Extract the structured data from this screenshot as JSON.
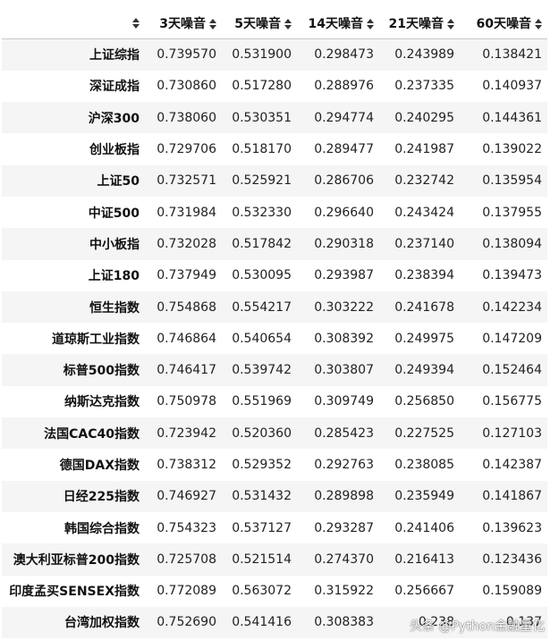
{
  "table": {
    "headers": [
      "3天噪音",
      "5天噪音",
      "14天噪音",
      "21天噪音",
      "60天噪音"
    ],
    "rows": [
      {
        "name": "上证综指",
        "values": [
          "0.739570",
          "0.531900",
          "0.298473",
          "0.243989",
          "0.138421"
        ]
      },
      {
        "name": "深证成指",
        "values": [
          "0.730860",
          "0.517280",
          "0.288976",
          "0.237335",
          "0.140937"
        ]
      },
      {
        "name": "沪深300",
        "values": [
          "0.738060",
          "0.530351",
          "0.294774",
          "0.240295",
          "0.144361"
        ]
      },
      {
        "name": "创业板指",
        "values": [
          "0.729706",
          "0.518170",
          "0.289477",
          "0.241987",
          "0.139022"
        ]
      },
      {
        "name": "上证50",
        "values": [
          "0.732571",
          "0.525921",
          "0.286706",
          "0.232742",
          "0.135954"
        ]
      },
      {
        "name": "中证500",
        "values": [
          "0.731984",
          "0.532330",
          "0.296640",
          "0.243424",
          "0.137955"
        ]
      },
      {
        "name": "中小板指",
        "values": [
          "0.732028",
          "0.517842",
          "0.290318",
          "0.237140",
          "0.138094"
        ]
      },
      {
        "name": "上证180",
        "values": [
          "0.737949",
          "0.530095",
          "0.293987",
          "0.238394",
          "0.139473"
        ]
      },
      {
        "name": "恒生指数",
        "values": [
          "0.754868",
          "0.554217",
          "0.303222",
          "0.241678",
          "0.142234"
        ]
      },
      {
        "name": "道琼斯工业指数",
        "values": [
          "0.746864",
          "0.540654",
          "0.308392",
          "0.249975",
          "0.147209"
        ]
      },
      {
        "name": "标普500指数",
        "values": [
          "0.746417",
          "0.539742",
          "0.303807",
          "0.249394",
          "0.152464"
        ]
      },
      {
        "name": "纳斯达克指数",
        "values": [
          "0.750978",
          "0.551969",
          "0.309749",
          "0.256850",
          "0.156775"
        ]
      },
      {
        "name": "法国CAC40指数",
        "values": [
          "0.723942",
          "0.520360",
          "0.285423",
          "0.227525",
          "0.127103"
        ]
      },
      {
        "name": "德国DAX指数",
        "values": [
          "0.738312",
          "0.529352",
          "0.292763",
          "0.238085",
          "0.142387"
        ]
      },
      {
        "name": "日经225指数",
        "values": [
          "0.746927",
          "0.531432",
          "0.289898",
          "0.235949",
          "0.141867"
        ]
      },
      {
        "name": "韩国综合指数",
        "values": [
          "0.754323",
          "0.537127",
          "0.293287",
          "0.241406",
          "0.139623"
        ]
      },
      {
        "name": "澳大利亚标普200指数",
        "values": [
          "0.725708",
          "0.521514",
          "0.274370",
          "0.216413",
          "0.123436"
        ]
      },
      {
        "name": "印度孟买SENSEX指数",
        "values": [
          "0.772089",
          "0.563072",
          "0.315922",
          "0.256667",
          "0.159089"
        ]
      },
      {
        "name": "台湾加权指数",
        "values": [
          "0.752690",
          "0.541416",
          "0.308383",
          "0.238",
          "0.137"
        ]
      }
    ]
  },
  "watermark": "头条 @Python金融量化",
  "icons": {
    "sort": "sort-icon"
  }
}
